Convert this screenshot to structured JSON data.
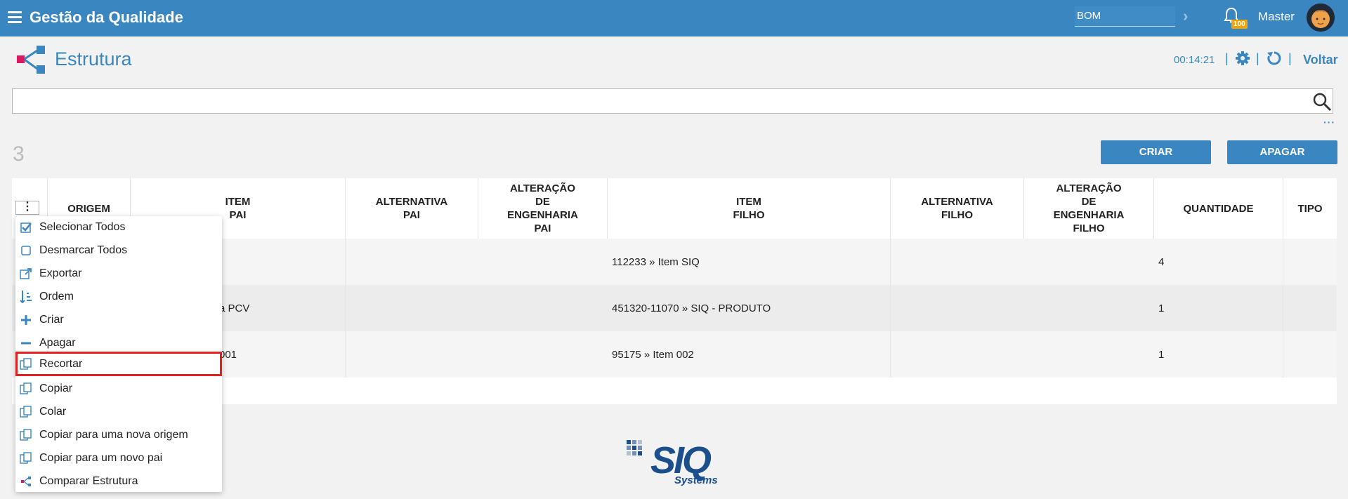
{
  "header": {
    "app_title": "Gestão da Qualidade",
    "context_field_value": "BOM",
    "notification_count": "100",
    "user_name": "Master"
  },
  "page": {
    "title": "Estrutura",
    "timer": "00:14:21",
    "back_label": "Voltar",
    "record_count": "3"
  },
  "search": {
    "placeholder": "",
    "value": ""
  },
  "toolbar": {
    "create_label": "CRIAR",
    "delete_label": "APAGAR"
  },
  "table": {
    "columns": [
      "ORIGEM",
      "ITEM\nPAI",
      "ALTERNATIVA\nPAI",
      "ALTERAÇÃO\nDE\nENGENHARIA\nPAI",
      "ITEM\nFILHO",
      "ALTERNATIVA\nFILHO",
      "ALTERAÇÃO\nDE\nENGENHARIA\nFILHO",
      "QUANTIDADE",
      "TIPO"
    ],
    "rows": [
      {
        "item_pai": "",
        "item_filho": "112233 » Item SIQ",
        "quantidade": "4"
      },
      {
        "item_pai": "a PCV",
        "item_filho": "451320-11070 » SIQ - PRODUTO",
        "quantidade": "1"
      },
      {
        "item_pai": "001",
        "item_filho": "95175 » Item 002",
        "quantidade": "1"
      }
    ]
  },
  "context_menu": {
    "items": [
      {
        "label": "Selecionar Todos",
        "icon": "checkbox-checked-icon"
      },
      {
        "label": "Desmarcar Todos",
        "icon": "checkbox-empty-icon"
      },
      {
        "label": "Exportar",
        "icon": "export-icon"
      },
      {
        "label": "Ordem",
        "icon": "sort-order-icon"
      },
      {
        "label": "Criar",
        "icon": "plus-icon"
      },
      {
        "label": "Apagar",
        "icon": "minus-icon"
      },
      {
        "label": "Recortar",
        "icon": "cut-icon",
        "highlighted": true
      },
      {
        "label": "Copiar",
        "icon": "copy-icon"
      },
      {
        "label": "Colar",
        "icon": "paste-icon"
      },
      {
        "label": "Copiar para uma nova origem",
        "icon": "copy-icon"
      },
      {
        "label": "Copiar para um novo pai",
        "icon": "copy-icon"
      },
      {
        "label": "Comparar Estrutura",
        "icon": "structure-icon"
      }
    ]
  },
  "footer": {
    "logo_text": "SIQ",
    "logo_subtext": "Systems"
  },
  "colors": {
    "primary": "#3a86c0",
    "highlight": "#e32020",
    "badge": "#f4a300"
  }
}
